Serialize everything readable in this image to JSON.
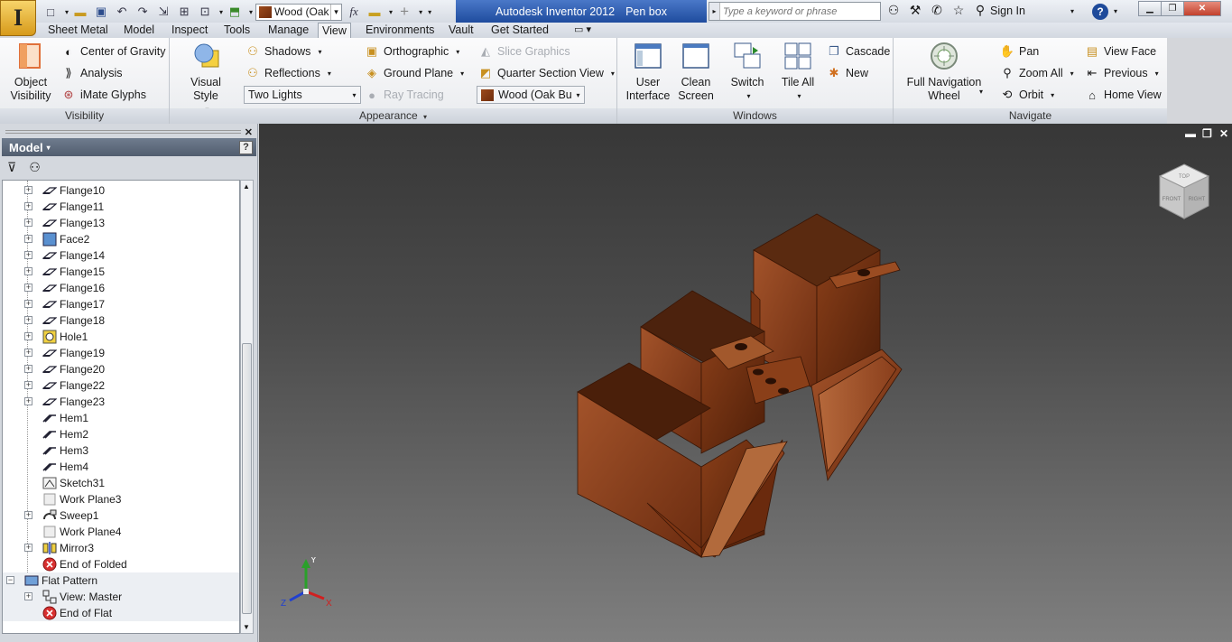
{
  "app": {
    "logo": "I",
    "product": "Autodesk Inventor 2012",
    "document": "Pen box"
  },
  "qat": {
    "material": "Wood (Oak",
    "fx_symbol": "fx"
  },
  "search": {
    "placeholder": "Type a keyword or phrase"
  },
  "signin": "Sign In",
  "help": "?",
  "tabs": [
    "Sheet Metal",
    "Model",
    "Inspect",
    "Tools",
    "Manage",
    "View",
    "Environments",
    "Vault",
    "Get Started"
  ],
  "active_tab": "View",
  "ribbon": {
    "visibility": {
      "title": "Visibility",
      "object_visibility": [
        "Object",
        "Visibility"
      ],
      "center_of_gravity": "Center of Gravity",
      "analysis": "Analysis",
      "imate_glyphs": "iMate Glyphs"
    },
    "appearance": {
      "title": "Appearance",
      "visual_style": "Visual Style",
      "shadows": "Shadows",
      "reflections": "Reflections",
      "lighting": "Two Lights",
      "orthographic": "Orthographic",
      "ground_plane": "Ground Plane",
      "ray_tracing": "Ray Tracing",
      "slice_graphics": "Slice Graphics",
      "quarter_section_view": "Quarter Section View",
      "material": "Wood (Oak Bu"
    },
    "windows": {
      "title": "Windows",
      "user_interface": [
        "User",
        "Interface"
      ],
      "clean_screen": [
        "Clean",
        "Screen"
      ],
      "switch": "Switch",
      "tile_all": "Tile All",
      "cascade": "Cascade",
      "new": "New"
    },
    "navigate": {
      "title": "Navigate",
      "full_nav_wheel": [
        "Full Navigation",
        "Wheel"
      ],
      "pan": "Pan",
      "zoom_all": "Zoom All",
      "orbit": "Orbit",
      "view_face": "View Face",
      "previous": "Previous",
      "home_view": "Home View"
    }
  },
  "browser": {
    "title": "Model",
    "items": [
      {
        "label": "Flange10",
        "icon": "flange-icon",
        "expander": true
      },
      {
        "label": "Flange11",
        "icon": "flange-icon",
        "expander": true
      },
      {
        "label": "Flange13",
        "icon": "flange-icon",
        "expander": true
      },
      {
        "label": "Face2",
        "icon": "face-icon",
        "expander": true
      },
      {
        "label": "Flange14",
        "icon": "flange-icon",
        "expander": true
      },
      {
        "label": "Flange15",
        "icon": "flange-icon",
        "expander": true
      },
      {
        "label": "Flange16",
        "icon": "flange-icon",
        "expander": true
      },
      {
        "label": "Flange17",
        "icon": "flange-icon",
        "expander": true
      },
      {
        "label": "Flange18",
        "icon": "flange-icon",
        "expander": true
      },
      {
        "label": "Hole1",
        "icon": "hole-icon",
        "expander": true
      },
      {
        "label": "Flange19",
        "icon": "flange-icon",
        "expander": true
      },
      {
        "label": "Flange20",
        "icon": "flange-icon",
        "expander": true
      },
      {
        "label": "Flange22",
        "icon": "flange-icon",
        "expander": true
      },
      {
        "label": "Flange23",
        "icon": "flange-icon",
        "expander": true
      },
      {
        "label": "Hem1",
        "icon": "hem-icon",
        "expander": false
      },
      {
        "label": "Hem2",
        "icon": "hem-icon",
        "expander": false
      },
      {
        "label": "Hem3",
        "icon": "hem-icon",
        "expander": false
      },
      {
        "label": "Hem4",
        "icon": "hem-icon",
        "expander": false
      },
      {
        "label": "Sketch31",
        "icon": "sketch-icon",
        "expander": false
      },
      {
        "label": "Work Plane3",
        "icon": "work-plane-icon",
        "expander": false
      },
      {
        "label": "Sweep1",
        "icon": "sweep-icon",
        "expander": true
      },
      {
        "label": "Work Plane4",
        "icon": "work-plane-icon",
        "expander": false
      },
      {
        "label": "Mirror3",
        "icon": "mirror-icon",
        "expander": true
      },
      {
        "label": "End of Folded",
        "icon": "end-of-part-icon",
        "expander": false
      },
      {
        "label": "Flat Pattern",
        "icon": "flat-pattern-icon",
        "expander": true,
        "level": 0,
        "open": true
      },
      {
        "label": "View: Master",
        "icon": "view-icon",
        "expander": true
      },
      {
        "label": "End of Flat",
        "icon": "end-of-part-icon",
        "expander": false
      }
    ]
  },
  "viewcube": {
    "faces": [
      "TOP",
      "FRONT",
      "RIGHT"
    ]
  },
  "triad": {
    "x": "X",
    "y": "Y",
    "z": "Z"
  },
  "colors": {
    "wood": "#8a3d17",
    "title_blue": "#2a5aae",
    "viewport_top": "#373737",
    "viewport_bottom": "#7f7f7f"
  }
}
